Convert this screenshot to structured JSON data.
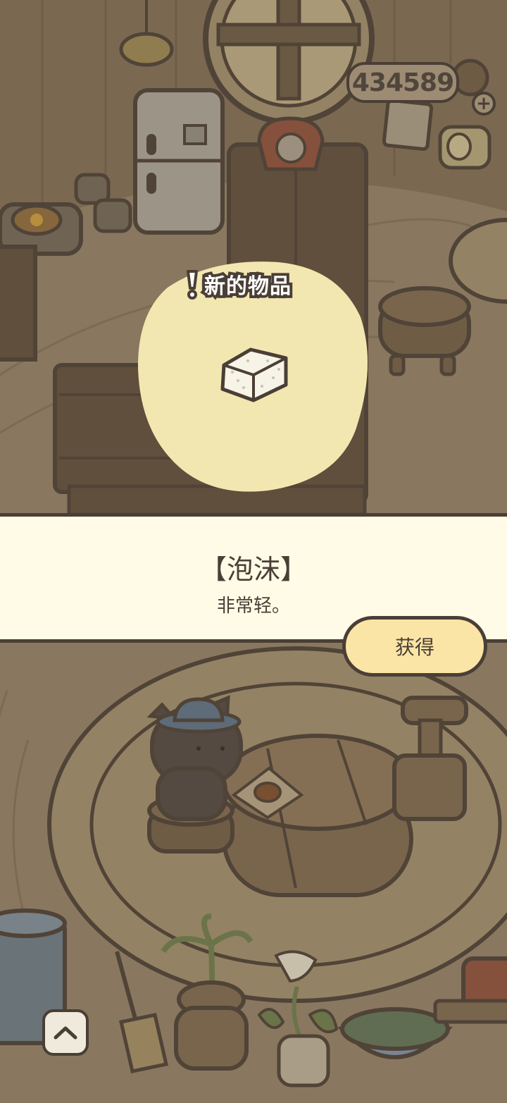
{
  "currency": {
    "amount": "434589",
    "add_icon": "plus-icon"
  },
  "new_item": {
    "tag_label": "新的物品",
    "tag_icon": "exclamation-icon",
    "item_icon": "foam-block-icon"
  },
  "item_info": {
    "name": "【泡沫】",
    "description": "非常轻。"
  },
  "actions": {
    "obtain_label": "获得",
    "collapse_icon": "chevron-up-icon"
  },
  "colors": {
    "outline": "#4a3f36",
    "info_band_bg": "#fffbe6",
    "button_bg": "#fbe5a6",
    "spotlight": "#f7eaaa",
    "dim_room": "#8a7a62"
  }
}
